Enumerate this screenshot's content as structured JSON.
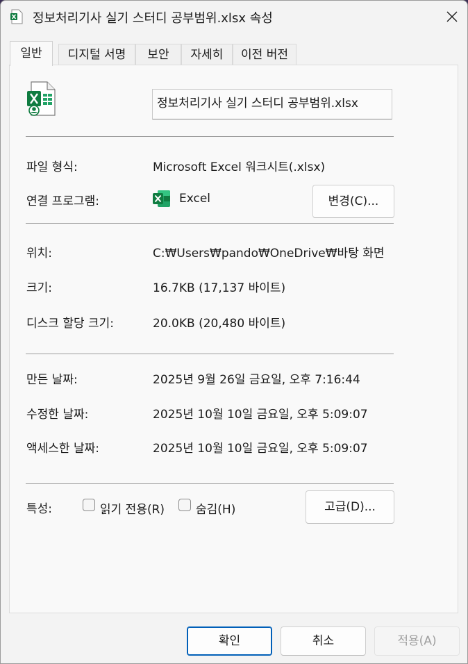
{
  "window": {
    "title": "정보처리기사 실기 스터디 공부범위.xlsx 속성",
    "close_label": "✕"
  },
  "tabs": [
    "일반",
    "디지털 서명",
    "보안",
    "자세히",
    "이전 버전"
  ],
  "general": {
    "file_name": "정보처리기사 실기 스터디 공부범위.xlsx",
    "type_label": "파일 형식:",
    "type_value": "Microsoft Excel 워크시트(.xlsx)",
    "opens_with_label": "연결 프로그램:",
    "opens_with_value": "Excel",
    "change_button": "변경(C)...",
    "location_label": "위치:",
    "location_value": "C:₩Users₩pando₩OneDrive₩바탕 화면",
    "size_label": "크기:",
    "size_value": "16.7KB (17,137 바이트)",
    "size_on_disk_label": "디스크 할당 크기:",
    "size_on_disk_value": "20.0KB (20,480 바이트)",
    "created_label": "만든 날짜:",
    "created_value": "2025년 9월 26일 금요일, 오후 7:16:44",
    "modified_label": "수정한 날짜:",
    "modified_value": "2025년 10월 10일 금요일, 오후 5:09:07",
    "accessed_label": "액세스한 날짜:",
    "accessed_value": "2025년 10월 10일 금요일, 오후 5:09:07",
    "attributes_label": "특성:",
    "readonly_label": "읽기 전용(R)",
    "readonly_checked": false,
    "hidden_label": "숨김(H)",
    "hidden_checked": false,
    "advanced_button": "고급(D)..."
  },
  "footer": {
    "ok": "확인",
    "cancel": "취소",
    "apply": "적용(A)"
  },
  "colors": {
    "excel_green": "#107c41",
    "accent": "#005fb8"
  },
  "icons": {
    "title": "excel-file-icon",
    "file": "excel-file-icon",
    "program": "excel-app-icon",
    "close": "close-icon"
  }
}
